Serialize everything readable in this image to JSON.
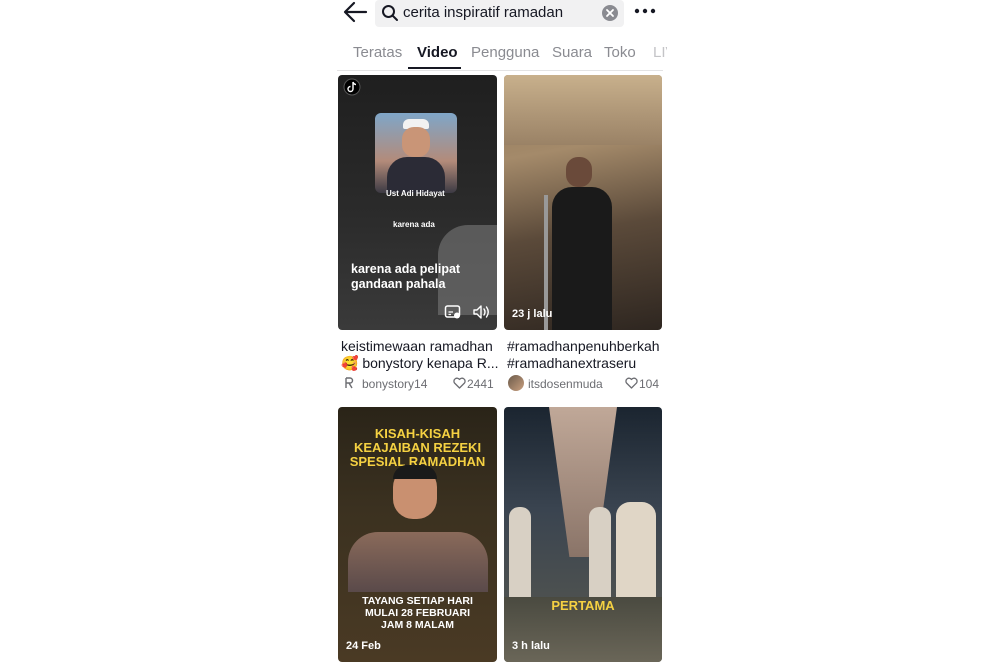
{
  "search": {
    "query": "cerita inspiratif ramadan"
  },
  "tabs": [
    {
      "label": "Teratas"
    },
    {
      "label": "Video"
    },
    {
      "label": "Pengguna"
    },
    {
      "label": "Suara"
    },
    {
      "label": "Toko"
    },
    {
      "label": "LIV"
    }
  ],
  "videos": [
    {
      "overlay_name": "Ust Adi Hidayat",
      "overlay_small": "karena ada",
      "overlay_text_1": "karena ada pelipat",
      "overlay_text_2": "gandaan pahala",
      "caption_1": "keistimewaan ramadhan",
      "caption_2": "bonystory kenapa R...",
      "emoji": "🥰",
      "user": "bonystory14",
      "likes": "2441"
    },
    {
      "stamp": "23 j lalu",
      "caption_1": "#ramadhanpenuhberkah",
      "caption_2": "#ramadhanextraseru",
      "user": "itsdosenmuda",
      "likes": "104"
    },
    {
      "title_1": "KISAH-KISAH",
      "title_2": "KEAJAIBAN REZEKI",
      "title_3": "SPESIAL RAMADHAN",
      "sched_1": "TAYANG SETIAP HARI",
      "sched_2": "MULAI 28 FEBRUARI",
      "sched_3": "JAM 8 MALAM",
      "stamp": "24 Feb"
    },
    {
      "overlay": "PERTAMA",
      "stamp": "3 h lalu"
    }
  ]
}
